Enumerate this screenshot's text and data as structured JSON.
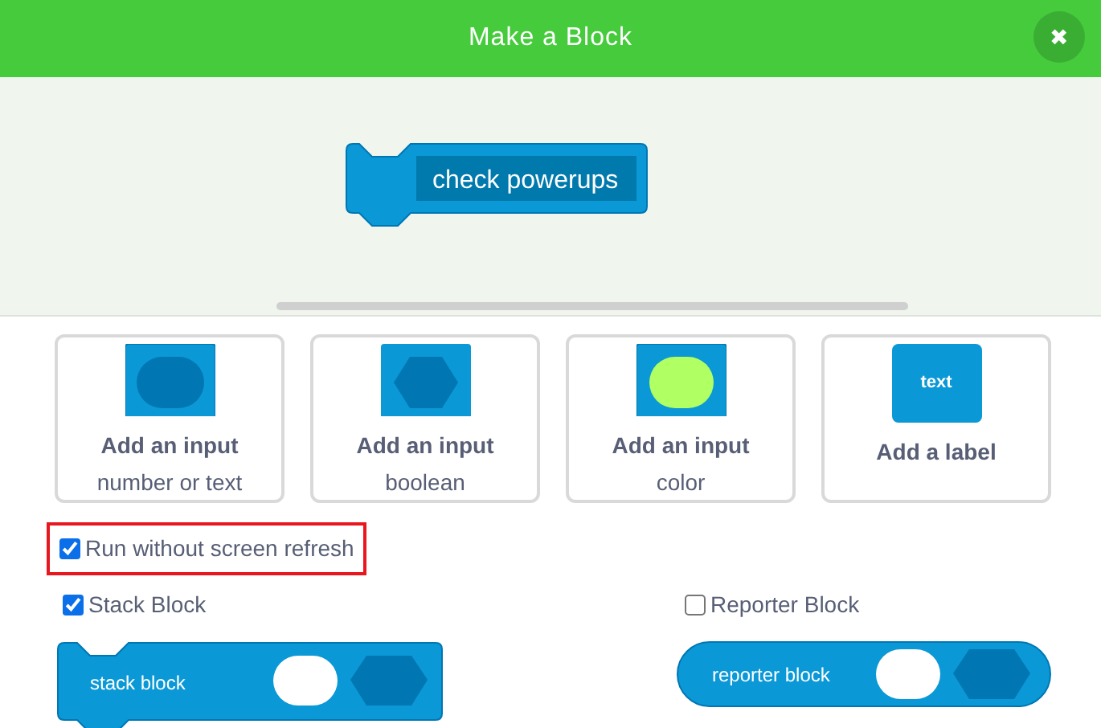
{
  "window": {
    "title": "Make a Block",
    "close_label": "✖"
  },
  "block": {
    "name": "check powerups"
  },
  "inputs": [
    {
      "kind": "number",
      "title": "Add an input",
      "subtitle": "number or text"
    },
    {
      "kind": "boolean",
      "title": "Add an input",
      "subtitle": "boolean"
    },
    {
      "kind": "color",
      "title": "Add an input",
      "subtitle": "color"
    },
    {
      "kind": "label",
      "title": "Add a label",
      "icon_text": "text"
    }
  ],
  "run_without_refresh": {
    "label": "Run without screen refresh",
    "checked": true,
    "highlighted": true
  },
  "block_types": [
    {
      "kind": "stack",
      "label": "Stack Block",
      "checked": true,
      "preview": "stack block"
    },
    {
      "kind": "reporter",
      "label": "Reporter Block",
      "checked": false,
      "preview": "reporter block"
    }
  ]
}
